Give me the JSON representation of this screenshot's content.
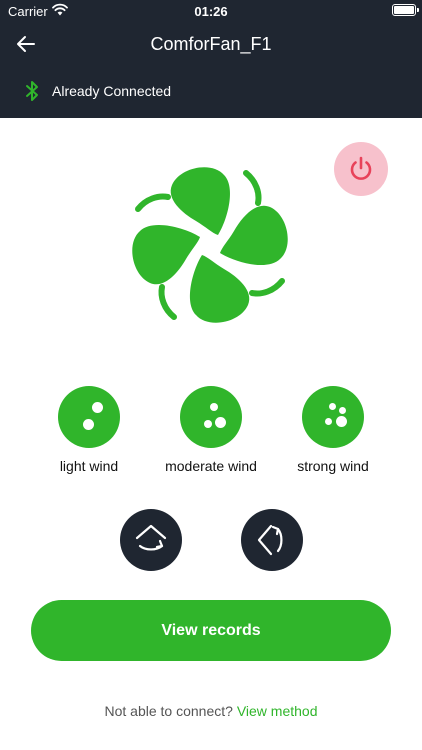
{
  "status_bar": {
    "carrier": "Carrier",
    "time": "01:26"
  },
  "header": {
    "title": "ComforFan_F1",
    "connection_status": "Already Connected"
  },
  "icons": {
    "back": "back-arrow-icon",
    "bluetooth": "bluetooth-icon",
    "power": "power-icon",
    "fan": "fan-icon",
    "oscillate_up_down": "oscillate-up-down-icon",
    "oscillate_left_right": "oscillate-left-right-icon"
  },
  "colors": {
    "header_bg": "#1f2631",
    "accent_green": "#30b52b",
    "power_bg": "#f7c1cc",
    "power_icon": "#e8425a",
    "dark_button": "#1f2631"
  },
  "wind_modes": [
    {
      "label": "light wind"
    },
    {
      "label": "moderate wind"
    },
    {
      "label": "strong wind"
    }
  ],
  "actions": {
    "view_records": "View records"
  },
  "help": {
    "question": "Not able to connect?",
    "link": "View method"
  }
}
